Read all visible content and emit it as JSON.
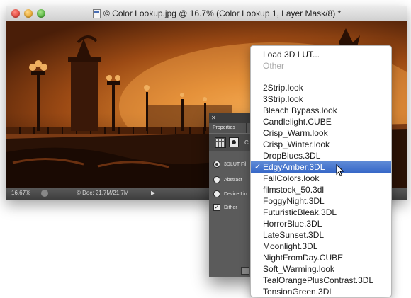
{
  "window": {
    "title": "© Color Lookup.jpg @ 16.7% (Color Lookup 1, Layer Mask/8) *"
  },
  "statusbar": {
    "zoom": "16.67%",
    "doc_size": "© Doc: 21.7M/21.7M"
  },
  "properties_panel": {
    "tab_label": "Properties",
    "adjustment_short": "C",
    "options": [
      {
        "label": "3DLUT Fil",
        "type": "radio",
        "selected": true
      },
      {
        "label": "Abstract",
        "type": "radio",
        "selected": false
      },
      {
        "label": "Device Lin",
        "type": "radio",
        "selected": false
      },
      {
        "label": "Dither",
        "type": "checkbox",
        "checked": true
      }
    ]
  },
  "menu": {
    "load_label": "Load 3D LUT...",
    "other_label": "Other",
    "items": [
      "2Strip.look",
      "3Strip.look",
      "Bleach Bypass.look",
      "Candlelight.CUBE",
      "Crisp_Warm.look",
      "Crisp_Winter.look",
      "DropBlues.3DL",
      "EdgyAmber.3DL",
      "FallColors.look",
      "filmstock_50.3dl",
      "FoggyNight.3DL",
      "FuturisticBleak.3DL",
      "HorrorBlue.3DL",
      "LateSunset.3DL",
      "Moonlight.3DL",
      "NightFromDay.CUBE",
      "Soft_Warming.look",
      "TealOrangePlusContrast.3DL",
      "TensionGreen.3DL"
    ],
    "selected_item": "EdgyAmber.3DL",
    "check_glyph": "✓"
  },
  "colors": {
    "menu_highlight": "#3768c8",
    "panel_bg": "#5b5b5b"
  }
}
